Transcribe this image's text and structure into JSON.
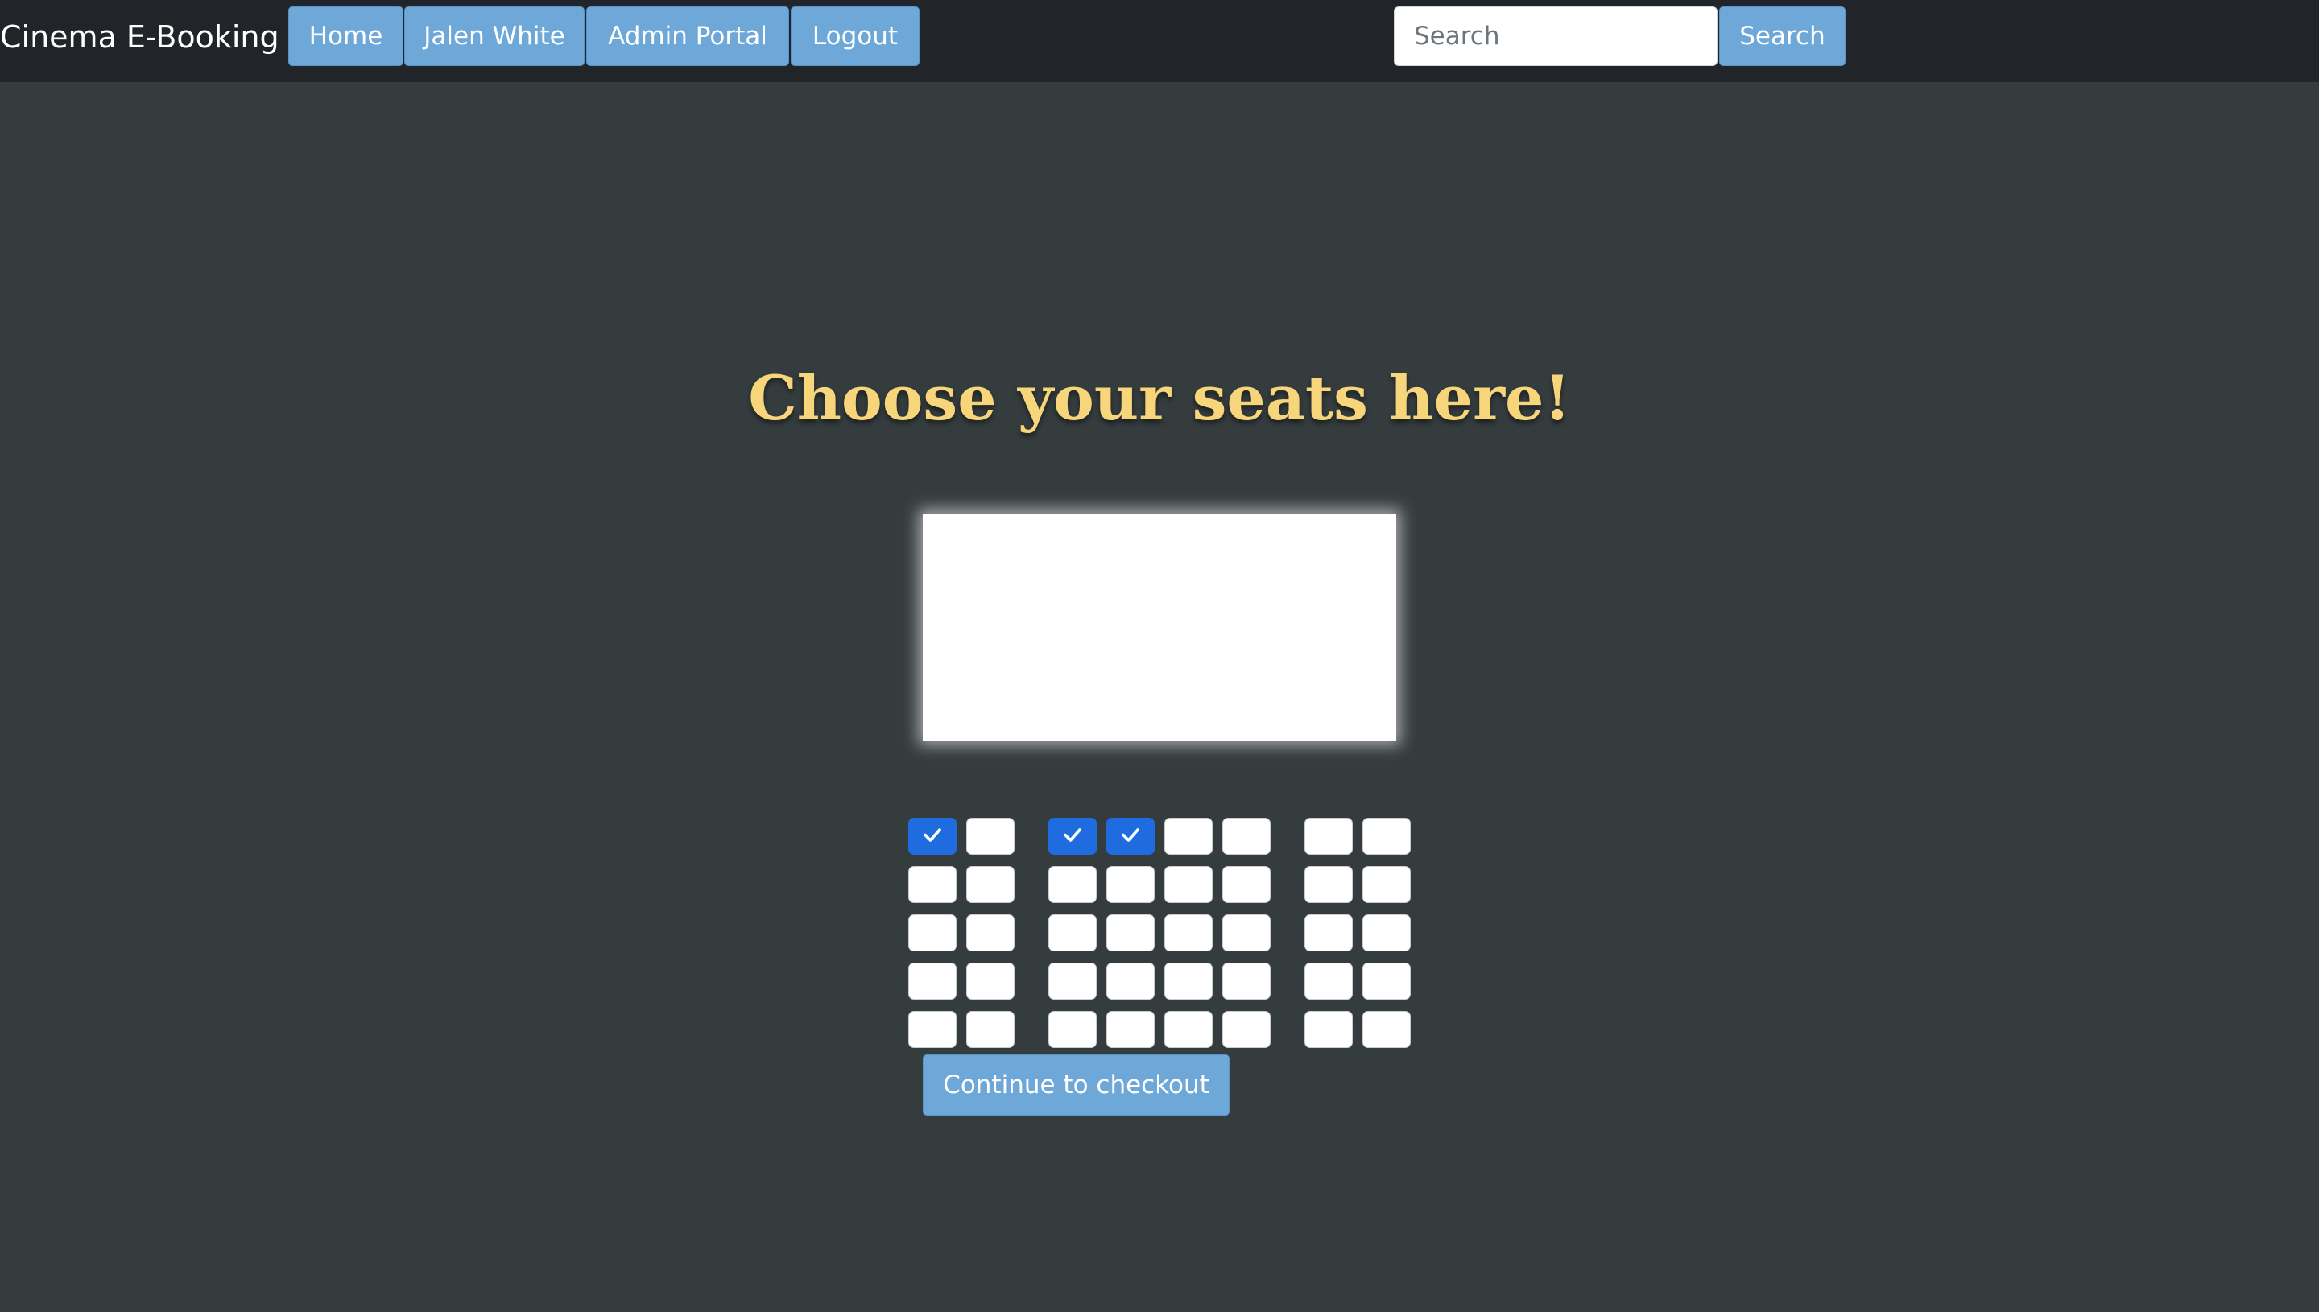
{
  "navbar": {
    "brand": "Cinema E-Booking",
    "links": [
      "Home",
      "Jalen White",
      "Admin Portal",
      "Logout"
    ],
    "search_placeholder": "Search",
    "search_button": "Search"
  },
  "main": {
    "heading": "Choose your seats here!",
    "checkout_button": "Continue to checkout"
  },
  "seats": {
    "rows": 5,
    "sections": [
      2,
      4,
      2
    ],
    "selected": [
      "r1-s1",
      "r1-s3",
      "r1-s4"
    ]
  },
  "colors": {
    "heading": "#f7d57a",
    "button": "#6ea8d8",
    "seat_selected": "#1f6ce0",
    "background": "#353c3e",
    "navbar": "#212529"
  },
  "icons": {
    "seat_check": "check-icon"
  }
}
